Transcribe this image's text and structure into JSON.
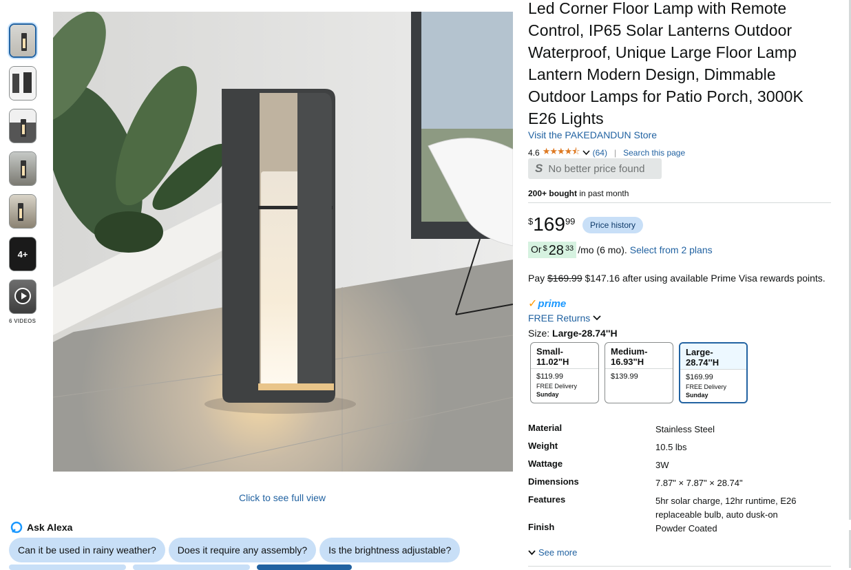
{
  "gallery": {
    "videos_label": "6 VIDEOS",
    "more_label": "4+",
    "full_view_link": "Click to see full view"
  },
  "product": {
    "title": "Led Corner Floor Lamp with Remote Control, IP65 Solar Lanterns Outdoor Waterproof, Unique Large Floor Lamp Lantern Modern Design, Dimmable Outdoor Lamps for Patio Porch, 3000K E26 Lights",
    "store_link": "Visit the PAKEDANDUN Store",
    "rating": "4.6",
    "stars": "★★★★⯪",
    "review_count": "(64)",
    "search_page": "Search this page",
    "no_better_price": "No better price found",
    "bought_bold": "200+ bought",
    "bought_rest": " in past month"
  },
  "price": {
    "currency": "$",
    "whole": "169",
    "fraction": "99",
    "history_badge": "Price history",
    "monthly_or": "Or ",
    "monthly_currency": "$",
    "monthly_whole": "28",
    "monthly_fraction": "33",
    "monthly_term": "/mo (6 mo).",
    "plans_link": "Select from 2 plans",
    "pay_prefix": "Pay ",
    "pay_strike": "$169.99",
    "pay_rest": " $147.16 after using available Prime Visa rewards points."
  },
  "shipping": {
    "prime_label": "prime",
    "free_returns": "FREE Returns"
  },
  "size": {
    "label": "Size: ",
    "selected": "Large-28.74''H",
    "options": [
      {
        "name": "Small-11.02\"H",
        "price": "$119.99",
        "delivery": "FREE Delivery",
        "day": "Sunday"
      },
      {
        "name": "Medium-16.93\"H",
        "price": "$139.99",
        "delivery": "",
        "day": ""
      },
      {
        "name": "Large-28.74''H",
        "price": "$169.99",
        "delivery": "FREE Delivery",
        "day": "Sunday"
      }
    ]
  },
  "specs": [
    {
      "key": "Material",
      "value": "Stainless Steel"
    },
    {
      "key": "Weight",
      "value": "10.5 lbs"
    },
    {
      "key": "Wattage",
      "value": "3W"
    },
    {
      "key": "Dimensions",
      "value": "7.87\" × 7.87\" × 28.74\""
    },
    {
      "key": "Features",
      "value": "5hr solar charge, 12hr runtime, E26 replaceable bulb, auto dusk-on"
    },
    {
      "key": "Finish",
      "value": "Powder Coated"
    }
  ],
  "see_more": "See more",
  "alexa": {
    "title": "Ask Alexa",
    "chips": [
      "Can it be used in rainy weather?",
      "Does it require any assembly?",
      "Is the brightness adjustable?"
    ]
  },
  "colors": {
    "link": "#2162a1",
    "star": "#de7921",
    "prime": "#1a98ff",
    "chip": "#c8dff7"
  }
}
